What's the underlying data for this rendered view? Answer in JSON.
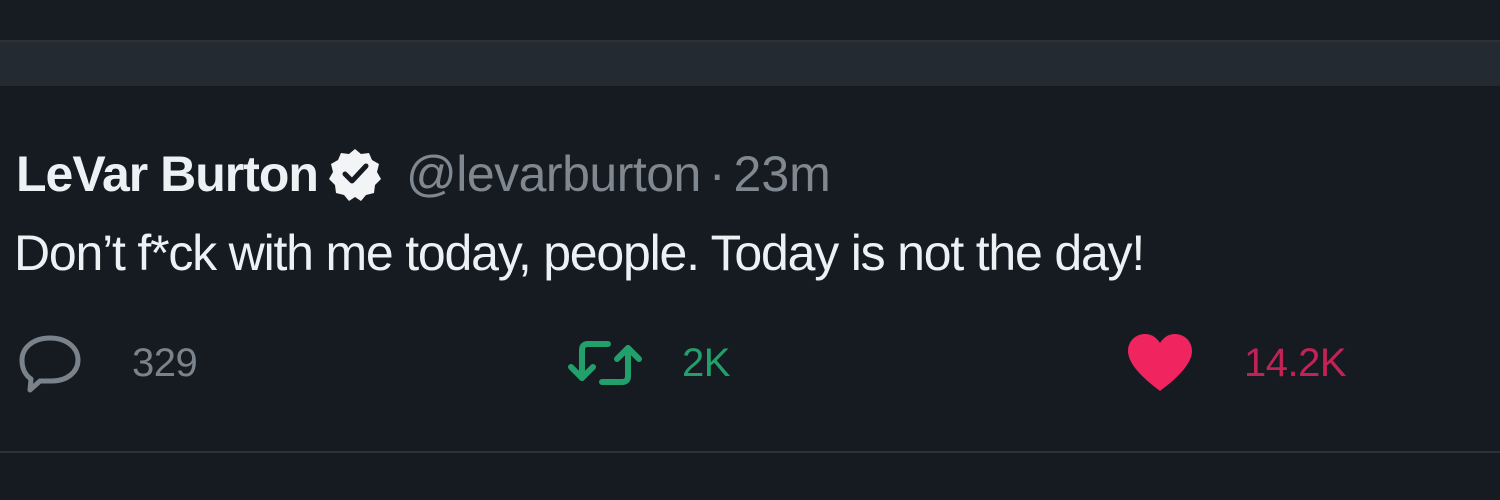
{
  "tweet": {
    "display_name": "LeVar Burton",
    "handle": "@levarburton",
    "separator": "·",
    "time": "23m",
    "text": "Don’t f*ck with me today, people. Today is not the day!"
  },
  "actions": {
    "reply_count": "329",
    "retweet_count": "2K",
    "like_count": "14.2K"
  },
  "icons": {
    "verified": "verified-badge-icon",
    "reply": "speech-bubble-icon",
    "retweet": "retweet-arrows-icon",
    "like": "heart-icon"
  },
  "colors": {
    "background": "#161b22",
    "retweet_green": "#22a06b",
    "like_pink": "#e0245e",
    "muted_text": "#7f8891"
  }
}
